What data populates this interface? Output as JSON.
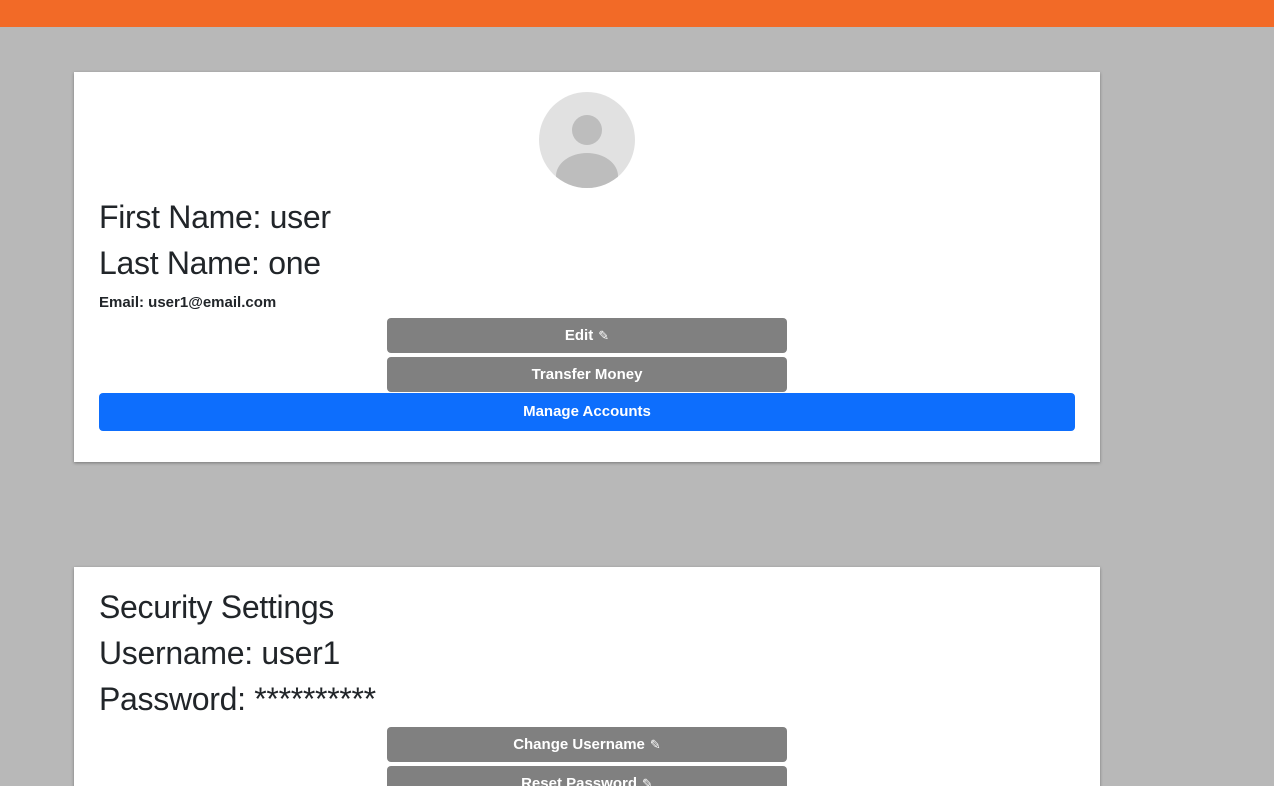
{
  "colors": {
    "topbar": "#f26a27",
    "page_background": "#b8b8b8",
    "card_background": "#ffffff",
    "gray_button": "#808080",
    "primary_button": "#0d6efd"
  },
  "profile": {
    "avatar_icon": "user-placeholder-icon",
    "first_name": "First Name: user",
    "last_name": "Last Name: one",
    "email": "Email: user1@email.com",
    "edit_label": "Edit",
    "transfer_label": "Transfer Money",
    "manage_label": "Manage Accounts"
  },
  "security": {
    "title": "Security Settings",
    "username": "Username: user1",
    "password": "Password: **********",
    "change_username_label": "Change Username",
    "reset_password_label": "Reset Password"
  },
  "icons": {
    "pencil": "✎"
  }
}
